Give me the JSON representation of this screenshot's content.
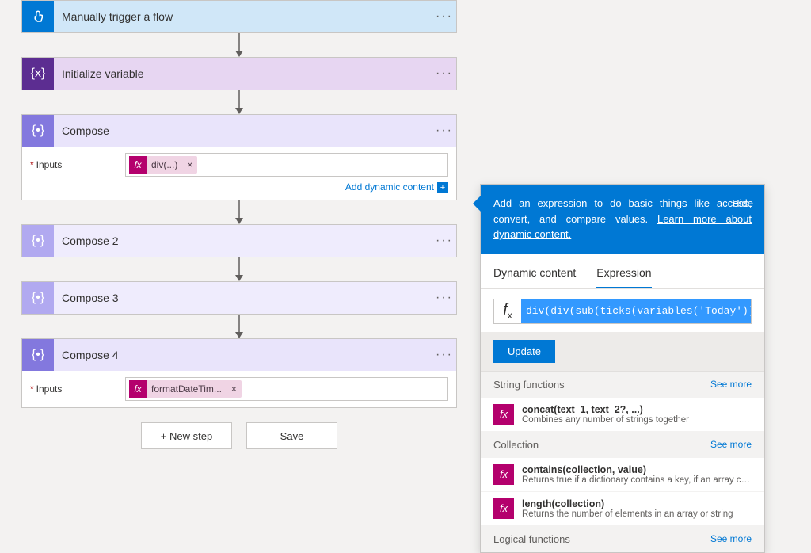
{
  "steps": {
    "trigger": {
      "title": "Manually trigger a flow"
    },
    "initvar": {
      "title": "Initialize variable"
    },
    "compose1": {
      "title": "Compose",
      "inputs_label": "Inputs",
      "token": "div(...)"
    },
    "compose2": {
      "title": "Compose 2"
    },
    "compose3": {
      "title": "Compose 3"
    },
    "compose4": {
      "title": "Compose 4",
      "inputs_label": "Inputs",
      "token": "formatDateTim..."
    }
  },
  "add_dynamic": "Add dynamic content",
  "buttons": {
    "new_step": "+ New step",
    "save": "Save"
  },
  "panel": {
    "banner_pre": "Add an expression to do basic things like access, convert, and compare values. ",
    "banner_link": "Learn more about dynamic content.",
    "hide": "Hide",
    "tabs": {
      "dynamic": "Dynamic content",
      "expression": "Expression"
    },
    "expression": "div(div(sub(ticks(variables('Today')),tic",
    "update": "Update",
    "see_more": "See more",
    "categories": [
      {
        "name": "String functions",
        "fns": [
          {
            "sig": "concat(text_1, text_2?, ...)",
            "desc": "Combines any number of strings together"
          }
        ]
      },
      {
        "name": "Collection",
        "fns": [
          {
            "sig": "contains(collection, value)",
            "desc": "Returns true if a dictionary contains a key, if an array cont..."
          },
          {
            "sig": "length(collection)",
            "desc": "Returns the number of elements in an array or string"
          }
        ]
      },
      {
        "name": "Logical functions",
        "fns": []
      }
    ]
  }
}
